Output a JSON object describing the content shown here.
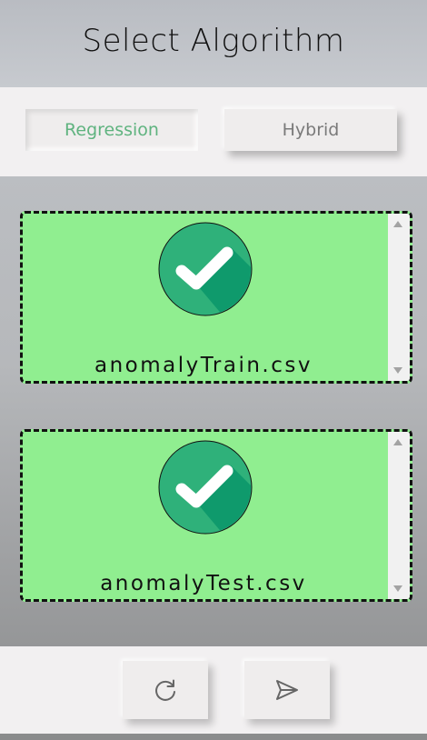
{
  "header": {
    "title": "Select Algorithm"
  },
  "tabs": [
    {
      "label": "Regression",
      "active": true
    },
    {
      "label": "Hybrid",
      "active": false
    }
  ],
  "uploads": [
    {
      "file_name": "anomalyTrain.csv",
      "status_icon": "check-circle-icon"
    },
    {
      "file_name": "anomalyTest.csv",
      "status_icon": "check-circle-icon"
    }
  ],
  "footer": {
    "reset_icon": "refresh-icon",
    "send_icon": "send-icon"
  },
  "colors": {
    "accent_green": "#5fb37f",
    "dropzone_bg": "#90ee90",
    "check_circle": "#2fb17a",
    "check_shadow": "#0f9a6c"
  }
}
